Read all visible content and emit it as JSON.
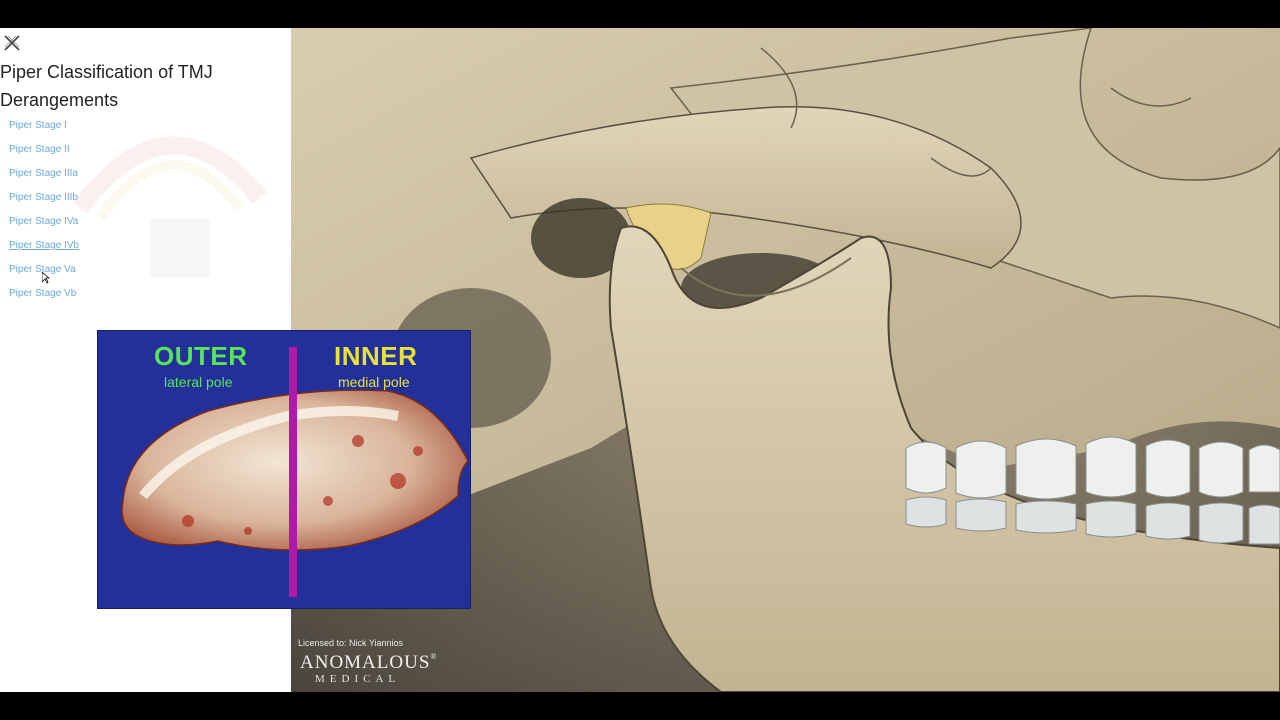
{
  "panel": {
    "title": "Piper Classification of TMJ Derangements",
    "close_icon": "close-x-icon",
    "stages": [
      "Piper Stage I",
      "Piper Stage II",
      "Piper Stage IIIa",
      "Piper Stage IIIb",
      "Piper Stage IVa",
      "Piper Stage IVb",
      "Piper Stage Va",
      "Piper Stage Vb"
    ],
    "hovered_stage": "Piper Stage IVb",
    "link_color": "#6ea8d4"
  },
  "photo": {
    "outer_label": "OUTER",
    "outer_sub": "lateral pole",
    "inner_label": "INNER",
    "inner_sub": "medial pole",
    "background": "#23309a",
    "outer_color": "#59e35a",
    "inner_color": "#e6e23a",
    "divider_color": "#b01aa8"
  },
  "footer": {
    "license": "Licensed to: Nick Yiannios",
    "logo_name": "ANOMALOUS",
    "logo_sub": "MEDICAL",
    "logo_mark": "®"
  }
}
